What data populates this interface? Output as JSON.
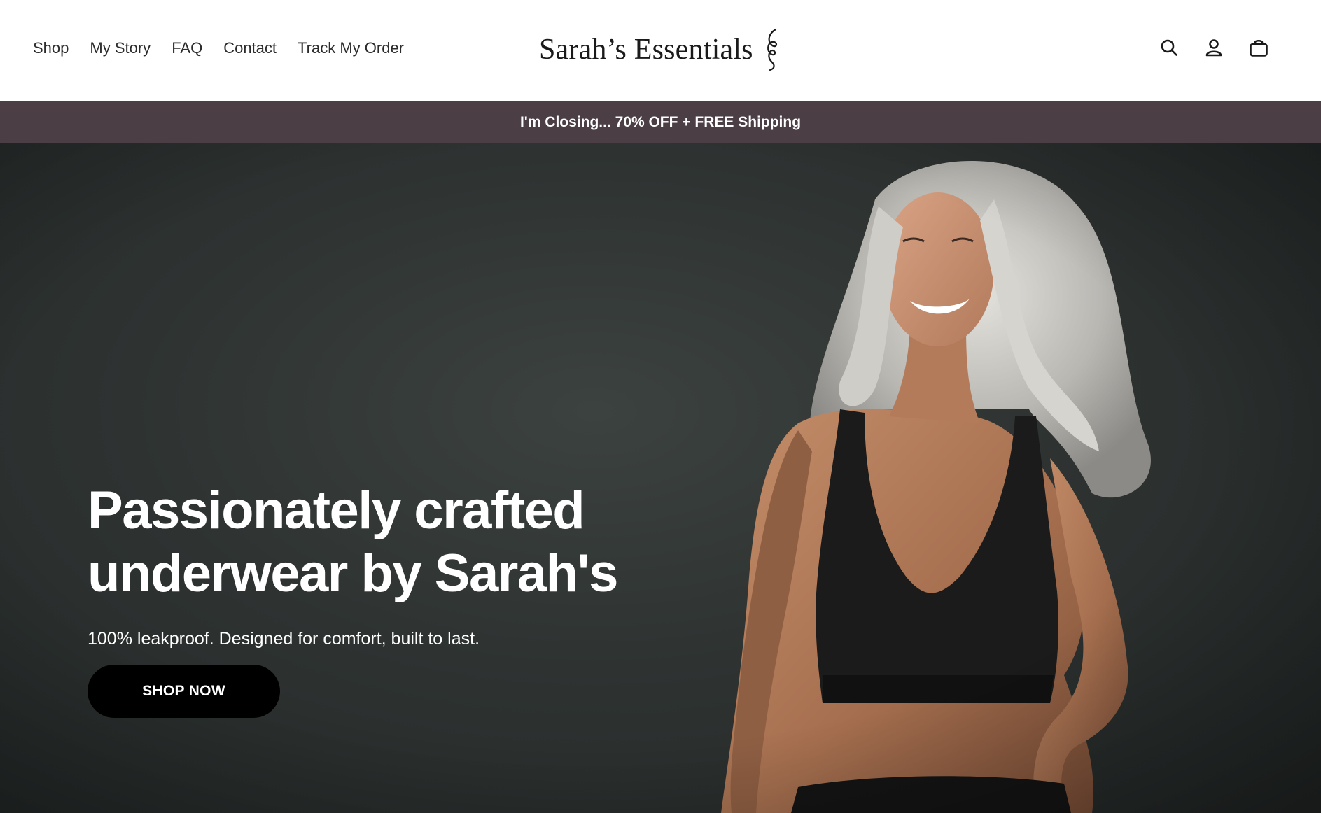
{
  "header": {
    "nav": [
      "Shop",
      "My Story",
      "FAQ",
      "Contact",
      "Track My Order"
    ],
    "logo_text": "Sarah’s Essentials",
    "icons": [
      "search-icon",
      "account-icon",
      "cart-icon"
    ]
  },
  "announcement": {
    "text": "I'm Closing... 70% OFF + FREE Shipping",
    "background": "#4b3f45"
  },
  "hero": {
    "title_line1": "Passionately crafted",
    "title_line2": "underwear by Sarah's",
    "subtitle": "100% leakproof. Designed for comfort, built to last.",
    "cta_label": "SHOP NOW",
    "background": "#2e3332"
  }
}
